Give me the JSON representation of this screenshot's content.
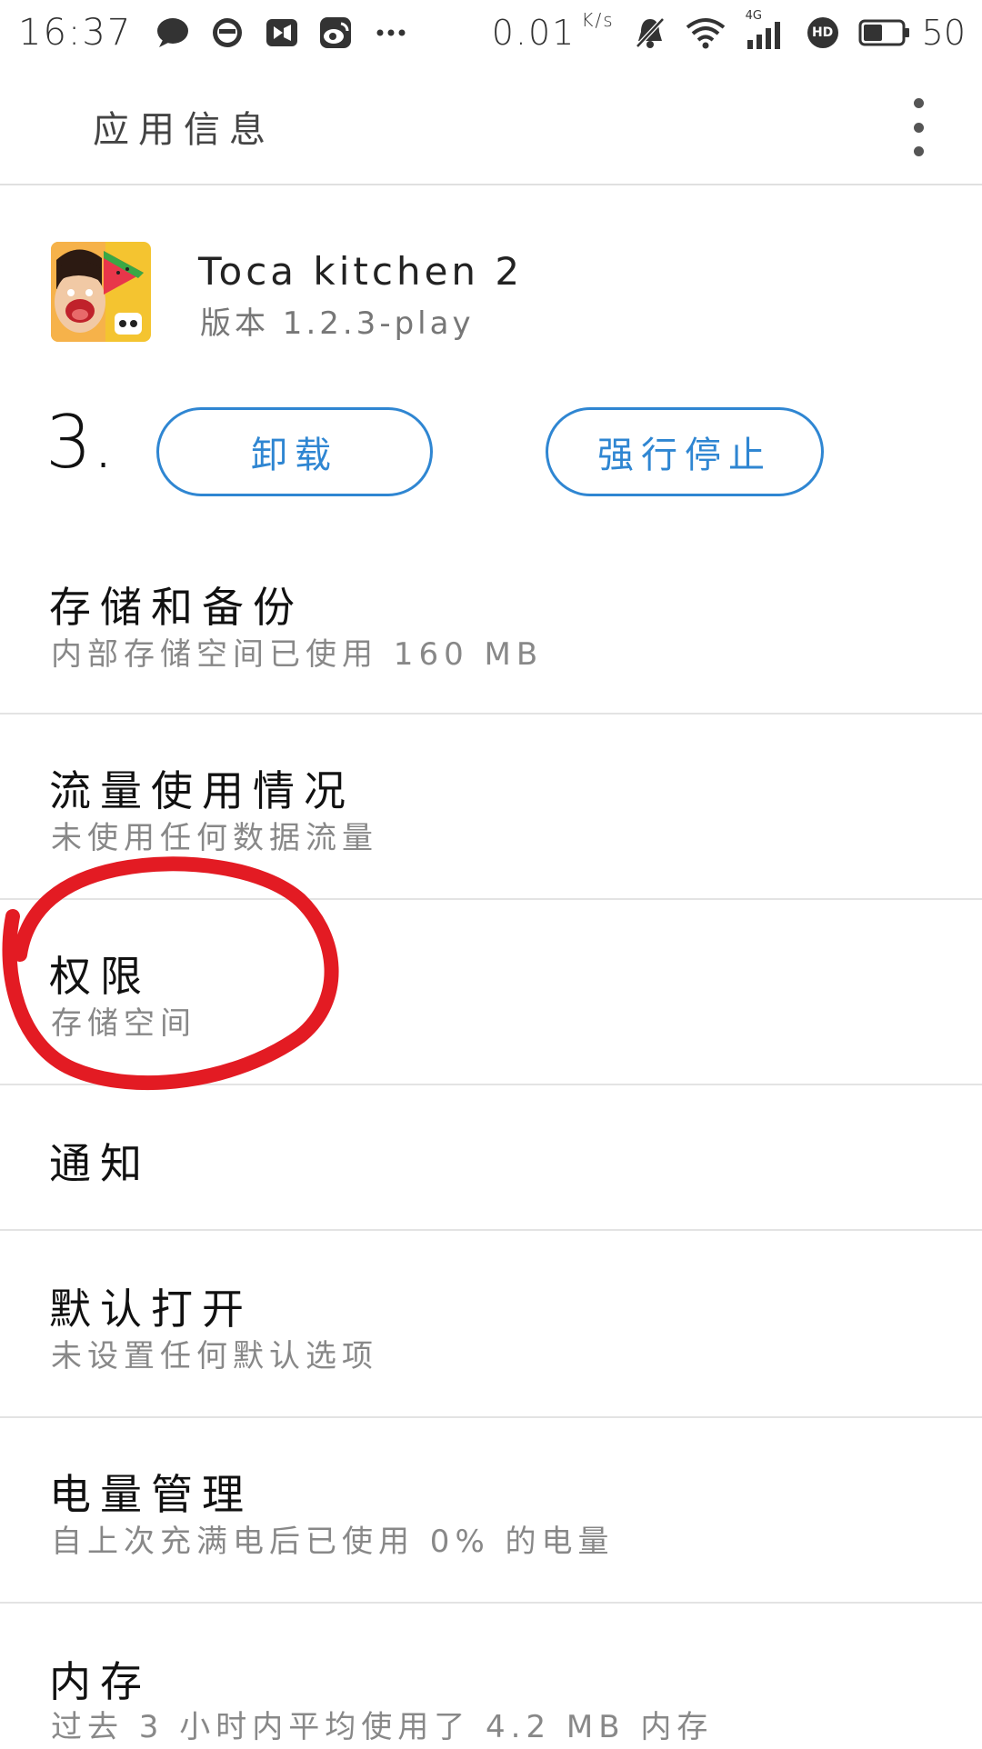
{
  "status_bar": {
    "time": "16:37",
    "left_icons": [
      "chat-bubble-icon",
      "circle-app-icon",
      "video-icon",
      "weibo-icon",
      "more-dots-icon"
    ],
    "net_speed": "0.01",
    "net_speed_unit": "K/s",
    "right_icons": [
      "muted-bell-icon",
      "wifi-icon",
      "signal-4g-icon",
      "hd-icon",
      "battery-icon"
    ],
    "network_type": "4G",
    "hd_label": "HD",
    "battery_level": "50",
    "battery_fill": 0.5
  },
  "header": {
    "title": "应用信息",
    "menu_icon": "more-vertical-icon"
  },
  "app": {
    "name": "Toca kitchen 2",
    "version": "版本 1.2.3-play",
    "icon": "toca-kitchen-app-icon"
  },
  "actions": {
    "step_label": "3.",
    "uninstall_label": "卸载",
    "force_stop_label": "强行停止"
  },
  "list": {
    "items": [
      {
        "title": "存储和备份",
        "subtitle": "内部存储空间已使用 160 MB"
      },
      {
        "title": "流量使用情况",
        "subtitle": "未使用任何数据流量"
      },
      {
        "title": "权限",
        "subtitle": "存储空间"
      },
      {
        "title": "通知",
        "subtitle": ""
      },
      {
        "title": "默认打开",
        "subtitle": "未设置任何默认选项"
      },
      {
        "title": "电量管理",
        "subtitle": "自上次充满电后已使用 0% 的电量"
      },
      {
        "title": "内存",
        "subtitle": "过去 3 小时内平均使用了 4.2 MB 内存"
      }
    ]
  },
  "annotation": {
    "color": "#e31b23",
    "target": "权限"
  },
  "colors": {
    "accent": "#2f86d2",
    "divider": "#e3e3e3",
    "annotation": "#e31b23"
  }
}
